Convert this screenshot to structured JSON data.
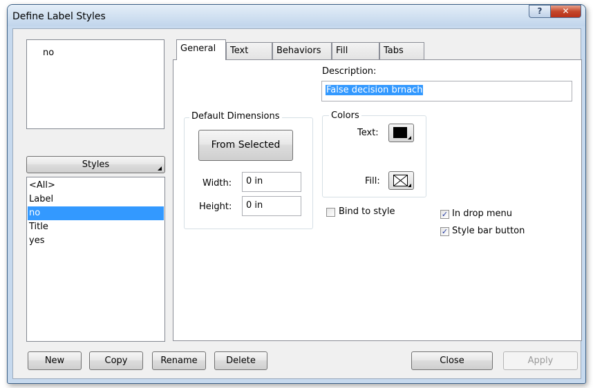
{
  "window": {
    "title": "Define Label Styles",
    "help_glyph": "?",
    "close_glyph": "✕"
  },
  "preview": {
    "text": "no"
  },
  "styles_button": {
    "label": "Styles"
  },
  "styles_list": {
    "items": [
      "<All>",
      "Label",
      "no",
      "Title",
      "yes"
    ],
    "selected": "no"
  },
  "tabs": [
    "General",
    "Text",
    "Behaviors",
    "Fill",
    "Tabs"
  ],
  "active_tab": "General",
  "general": {
    "description_label": "Description:",
    "description_value": "False decision brnach",
    "default_dimensions_title": "Default Dimensions",
    "from_selected_label": "From Selected",
    "width_label": "Width:",
    "width_value": "0 in",
    "height_label": "Height:",
    "height_value": "0 in",
    "colors_title": "Colors",
    "text_color_label": "Text:",
    "fill_color_label": "Fill:",
    "text_color": "#000000",
    "bind_to_style_label": "Bind to style",
    "bind_to_style_checked": false,
    "in_drop_menu_label": "In drop menu",
    "in_drop_menu_checked": true,
    "style_bar_button_label": "Style bar button",
    "style_bar_button_checked": true
  },
  "buttons": {
    "new": "New",
    "copy": "Copy",
    "rename": "Rename",
    "delete": "Delete",
    "close": "Close",
    "apply": "Apply"
  },
  "colors": {
    "selection": "#3399ff",
    "title_bar": "#c2d6ec",
    "close_button": "#c4472b"
  }
}
